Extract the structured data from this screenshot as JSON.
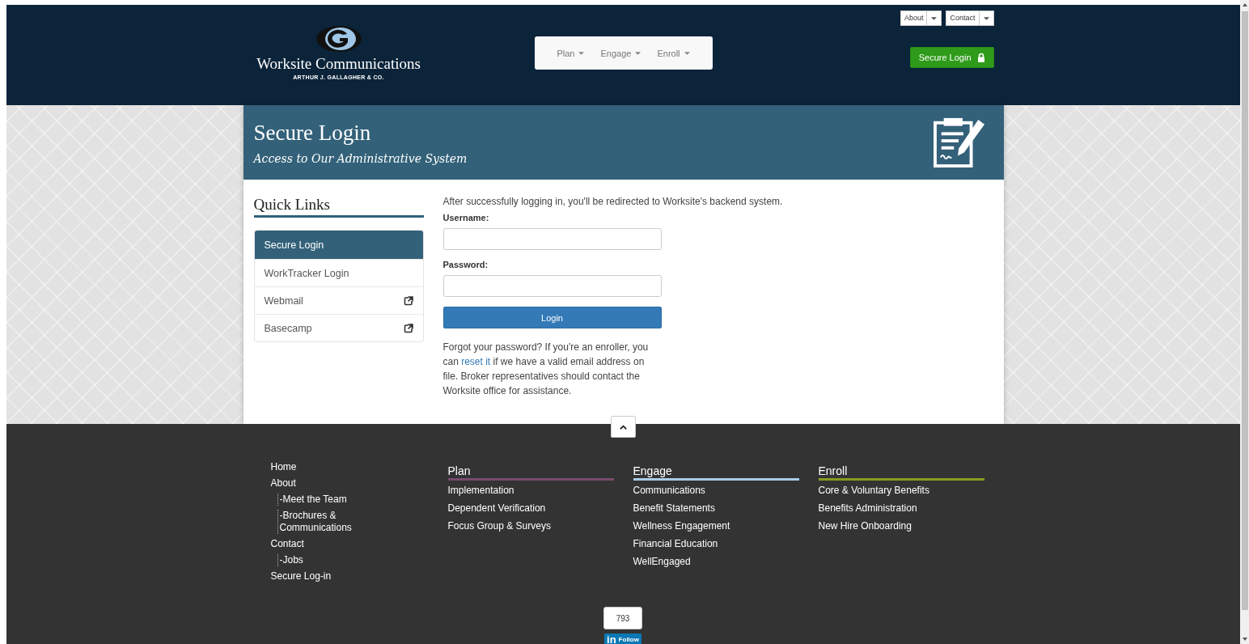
{
  "header": {
    "logo": {
      "name": "Worksite Communications",
      "company": "ARTHUR J. GALLAGHER & CO."
    },
    "nav": [
      {
        "label": "Plan"
      },
      {
        "label": "Engage"
      },
      {
        "label": "Enroll"
      }
    ],
    "top_links": [
      {
        "label": "About"
      },
      {
        "label": "Contact"
      }
    ],
    "login_button": "Secure Login"
  },
  "banner": {
    "title": "Secure Login",
    "subtitle": "Access to Our Administrative System"
  },
  "quick_links": {
    "title": "Quick Links",
    "items": [
      {
        "label": "Secure Login",
        "selected": true,
        "external": false
      },
      {
        "label": "WorkTracker Login",
        "selected": false,
        "external": false
      },
      {
        "label": "Webmail",
        "selected": false,
        "external": true
      },
      {
        "label": "Basecamp",
        "selected": false,
        "external": true
      }
    ]
  },
  "form": {
    "intro": "After successfully logging in, you'll be redirected to Worksite's backend system.",
    "fields": [
      {
        "label": "Username:"
      },
      {
        "label": "Password:"
      }
    ],
    "submit": "Login",
    "help_before": "Forgot your password? If you're an enroller, you can",
    "help_link": "reset it",
    "help_after": "if we have a valid email address on file. Broker representatives should contact the Worksite office for assistance."
  },
  "footer": {
    "sitemap": [
      {
        "label": "Home"
      },
      {
        "label": "About",
        "children": [
          {
            "label": "-Meet the Team"
          },
          {
            "label": "-Brochures & Communications"
          }
        ]
      },
      {
        "label": "Contact",
        "children": [
          {
            "label": "-Jobs"
          }
        ]
      },
      {
        "label": "Secure Log-in"
      }
    ],
    "columns": [
      {
        "title": "Plan",
        "color": "#7b4a6e",
        "links": [
          "Implementation",
          "Dependent Verification",
          "Focus Group & Surveys"
        ]
      },
      {
        "title": "Engage",
        "color": "#a9cbe6",
        "links": [
          "Communications",
          "Benefit Statements",
          "Wellness Engagement",
          "Financial Education",
          "WellEngaged"
        ]
      },
      {
        "title": "Enroll",
        "color": "#8a9a1e",
        "links": [
          "Core & Voluntary Benefits",
          "Benefits Administration",
          "New Hire Onboarding"
        ]
      }
    ]
  },
  "linkedin": {
    "count": "793",
    "logo": "in",
    "label": "Follow"
  }
}
